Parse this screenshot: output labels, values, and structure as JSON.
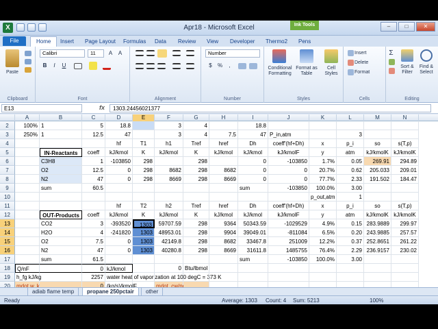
{
  "window": {
    "title": "Apr18 - Microsoft Excel",
    "ink_tools": "Ink Tools",
    "minimize": "–",
    "restore": "□",
    "close": "✕"
  },
  "tabs": {
    "file": "File",
    "home": "Home",
    "insert": "Insert",
    "page_layout": "Page Layout",
    "formulas": "Formulas",
    "data": "Data",
    "review": "Review",
    "view": "View",
    "developer": "Developer",
    "thermo2": "Thermo2",
    "pens": "Pens"
  },
  "ribbon": {
    "paste": "Paste",
    "clipboard": "Clipboard",
    "font_name": "Calibri",
    "font_size": "11",
    "font": "Font",
    "alignment": "Alignment",
    "number_format": "Number",
    "number": "Number",
    "cond_fmt": "Conditional Formatting",
    "format_table": "Format as Table",
    "cell_styles": "Cell Styles",
    "styles": "Styles",
    "insert": "Insert",
    "delete": "Delete",
    "format": "Format",
    "cells": "Cells",
    "sort_filter": "Sort & Filter",
    "find_select": "Find & Select",
    "editing": "Editing",
    "bold": "B",
    "italic": "I",
    "underline": "U",
    "sigma": "Σ",
    "dollar": "$",
    "percent": "%",
    "comma": ","
  },
  "formula_bar": {
    "name_box": "E13",
    "fx": "fx",
    "formula": "1303.24456021377"
  },
  "columns": [
    "A",
    "B",
    "C",
    "D",
    "E",
    "F",
    "G",
    "H",
    "I",
    "J",
    "K",
    "L",
    "M",
    "N"
  ],
  "rows": [
    {
      "n": "2",
      "cells": {
        "A": "100%",
        "B": "1",
        "C": "5",
        "D": "18.8",
        "F": "3",
        "G": "4",
        "I": "18.8"
      }
    },
    {
      "n": "3",
      "cells": {
        "A": "250%",
        "B": "1",
        "C": "12.5",
        "D": "47",
        "F": "3",
        "G": "4",
        "H": "7.5",
        "I": "47",
        "J": "P_in,atm",
        "L": "3"
      }
    },
    {
      "n": "4",
      "cells": {
        "D": "hf",
        "E": "T1",
        "F": "h1",
        "G": "Tref",
        "H": "href",
        "I": "Dh",
        "J": "coeff'(hf+Dh)",
        "K": "x",
        "L": "p_i",
        "M": "so",
        "N": "s(T,p)"
      }
    },
    {
      "n": "5",
      "cells": {
        "B": "IN-Reactants",
        "C": "coeff",
        "D": "kJ/kmol",
        "E": "K",
        "F": "kJ/kmol",
        "G": "K",
        "H": "kJ/kmol",
        "I": "kJ/kmol",
        "J": "kJ/kmolF",
        "K": "y",
        "L": "atm",
        "M": "kJ/kmolK",
        "N": "kJ/kmolK"
      }
    },
    {
      "n": "6",
      "cells": {
        "B": "C3H8",
        "C": "1",
        "D": "-103850",
        "E": "298",
        "G": "298",
        "I": "0",
        "J": "-103850",
        "K": "1.7%",
        "L": "0.05",
        "M": "269.91",
        "N": "294.89"
      }
    },
    {
      "n": "7",
      "cells": {
        "B": "O2",
        "C": "12.5",
        "D": "0",
        "E": "298",
        "F": "8682",
        "G": "298",
        "H": "8682",
        "I": "0",
        "J": "0",
        "K": "20.7%",
        "L": "0.62",
        "M": "205.033",
        "N": "209.01"
      }
    },
    {
      "n": "8",
      "cells": {
        "B": "N2",
        "C": "47",
        "D": "0",
        "E": "298",
        "F": "8669",
        "G": "298",
        "H": "8669",
        "I": "0",
        "J": "0",
        "K": "77.7%",
        "L": "2.33",
        "M": "191.502",
        "N": "184.47"
      }
    },
    {
      "n": "9",
      "cells": {
        "B": "sum",
        "C": "60.5",
        "I": "sum",
        "J": "-103850",
        "K": "100.0%",
        "L": "3.00"
      }
    },
    {
      "n": "10",
      "cells": {
        "K": "p_out,atm",
        "L": "1"
      }
    },
    {
      "n": "11",
      "cells": {
        "D": "hf",
        "E": "T2",
        "F": "h2",
        "G": "Tref",
        "H": "href",
        "I": "Dh",
        "J": "coeff'(hf+Dh)",
        "K": "x",
        "L": "p_i",
        "M": "so",
        "N": "s(T,p)"
      }
    },
    {
      "n": "12",
      "cells": {
        "B": "OUT-Products",
        "C": "coeff",
        "D": "kJ/kmol",
        "E": "K",
        "F": "kJ/kmol",
        "G": "K",
        "H": "kJ/kmol",
        "I": "kJ/kmol",
        "J": "kJ/kmolF",
        "K": "y",
        "L": "atm",
        "M": "kJ/kmolK",
        "N": "kJ/kmolK"
      }
    },
    {
      "n": "13",
      "cells": {
        "B": "CO2",
        "C": "3",
        "D": "-393520",
        "E": "1303",
        "F": "59707.59",
        "G": "298",
        "H": "9364",
        "I": "50343.59",
        "J": "-1029529",
        "K": "4.9%",
        "L": "0.15",
        "M": "283.9889",
        "N": "299.97"
      }
    },
    {
      "n": "14",
      "cells": {
        "B": "H2O",
        "C": "4",
        "D": "-241820",
        "E": "1303",
        "F": "48953.01",
        "G": "298",
        "H": "9904",
        "I": "39049.01",
        "J": "-811084",
        "K": "6.5%",
        "L": "0.20",
        "M": "243.9885",
        "N": "257.57"
      }
    },
    {
      "n": "15",
      "cells": {
        "B": "O2",
        "C": "7.5",
        "D": "0",
        "E": "1303",
        "F": "42149.8",
        "G": "298",
        "H": "8682",
        "I": "33467.8",
        "J": "251009",
        "K": "12.2%",
        "L": "0.37",
        "M": "252.8651",
        "N": "261.22"
      }
    },
    {
      "n": "16",
      "cells": {
        "B": "N2",
        "C": "47",
        "D": "0",
        "E": "1303",
        "F": "40280.8",
        "G": "298",
        "H": "8669",
        "I": "31611.8",
        "J": "1485755",
        "K": "76.4%",
        "L": "2.29",
        "M": "236.9157",
        "N": "230.02"
      }
    },
    {
      "n": "17",
      "cells": {
        "B": "sum",
        "C": "61.5",
        "I": "sum",
        "J": "-103850",
        "K": "100.0%",
        "L": "3.00"
      }
    },
    {
      "n": "18",
      "cells": {
        "A": "Q/nF",
        "C": "0",
        "D": "kJ/kmol",
        "F": "0",
        "G": "Btu/lbmol"
      }
    },
    {
      "n": "19",
      "cells": {
        "A": "h_fg kJ/kg",
        "C": "2257",
        "D": "water heat of vaporization at 100 degC = 373 K"
      }
    },
    {
      "n": "20",
      "cells": {
        "A": "mdot  w, kg/s",
        "C": "0",
        "D": "(kg/s)/kmolF",
        "F": "mdot_cw/ndot_fuel"
      }
    }
  ],
  "sheet_tabs": [
    "adiab flame temp",
    "propane 250pctair",
    "other"
  ],
  "status": {
    "ready": "Ready",
    "average": "Average: 1303",
    "count": "Count: 4",
    "sum": "Sum: 5213",
    "zoom": "100%"
  }
}
